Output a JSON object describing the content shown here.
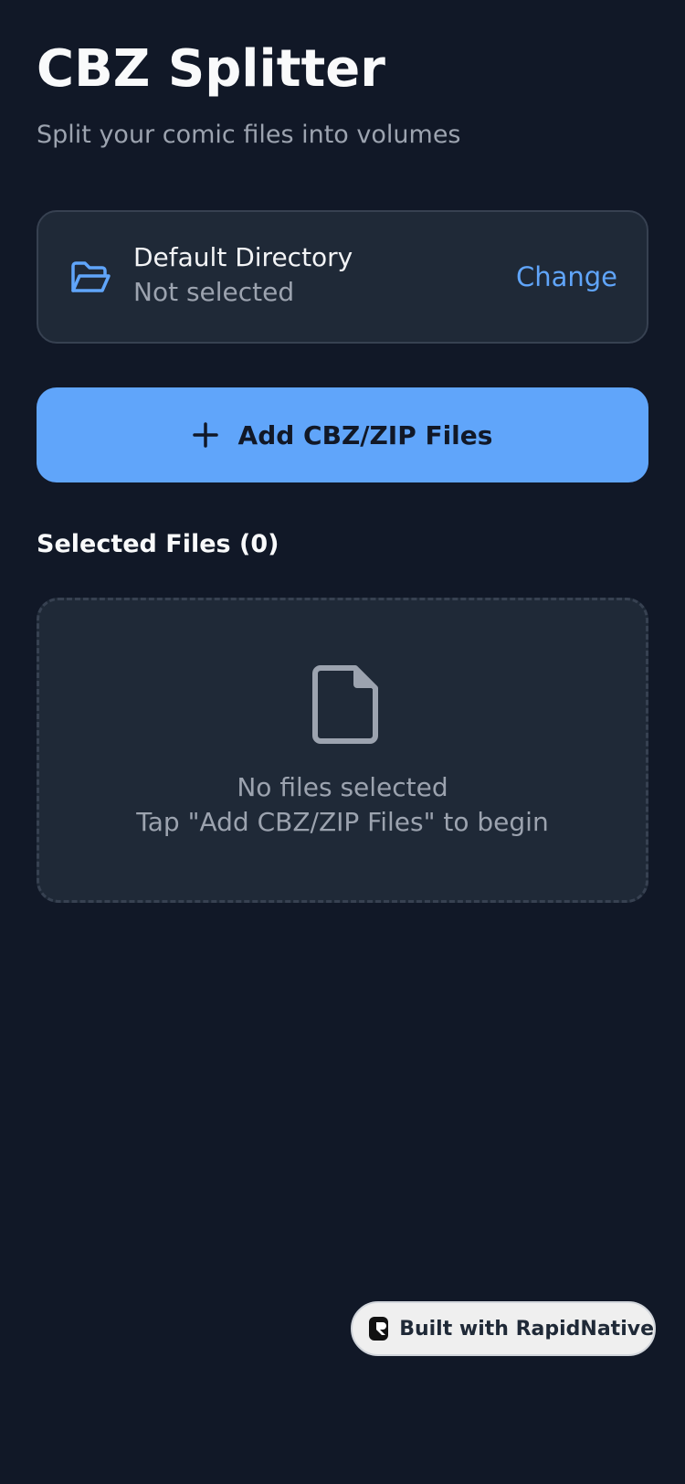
{
  "header": {
    "title": "CBZ Splitter",
    "subtitle": "Split your comic files into volumes"
  },
  "directory": {
    "icon": "folder-open-icon",
    "label": "Default Directory",
    "value": "Not selected",
    "action_label": "Change"
  },
  "add_button": {
    "icon": "plus-icon",
    "label": "Add CBZ/ZIP Files"
  },
  "selected_files": {
    "heading": "Selected Files (0)",
    "count": 0,
    "empty_icon": "file-icon",
    "empty_primary": "No files selected",
    "empty_secondary": "Tap \"Add CBZ/ZIP Files\" to begin"
  },
  "footer_badge": {
    "icon": "rapidnative-logo-icon",
    "label": "Built with RapidNative"
  },
  "colors": {
    "background": "#111827",
    "card": "#1f2937",
    "border": "#374151",
    "accent": "#60a5fa",
    "muted_text": "#9ca3af"
  }
}
